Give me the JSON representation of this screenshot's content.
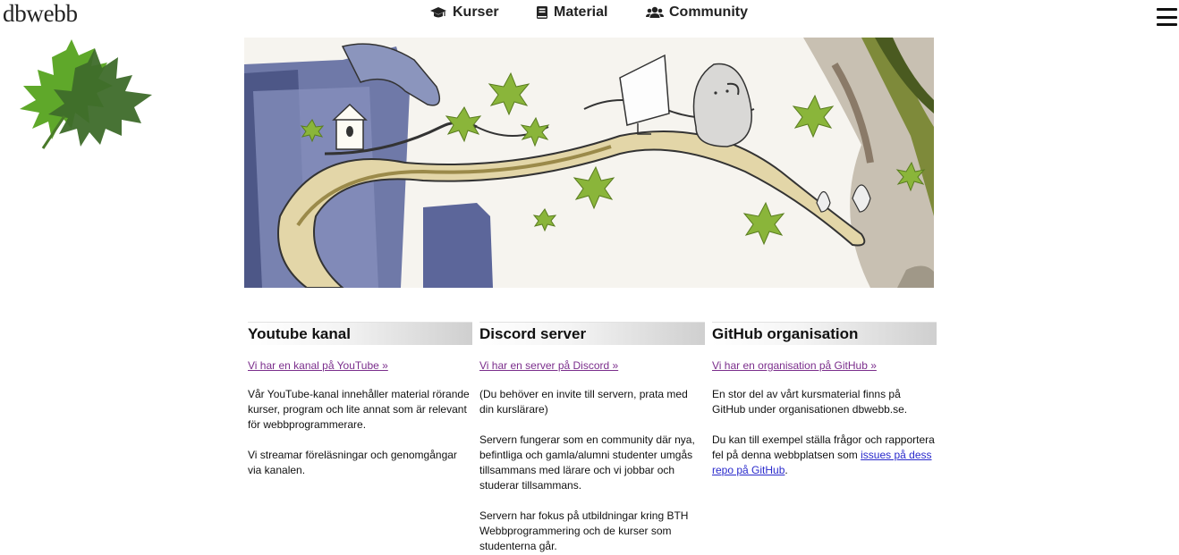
{
  "site": {
    "title": "dbwebb"
  },
  "nav": {
    "items": [
      {
        "label": "Kurser",
        "icon": "graduation-cap-icon"
      },
      {
        "label": "Material",
        "icon": "book-icon"
      },
      {
        "label": "Community",
        "icon": "users-icon"
      }
    ],
    "menu_icon": "hamburger-menu-icon"
  },
  "colors": {
    "link_visited": "#7b2e8c",
    "link": "#2a2acc",
    "leaf_light": "#5fa82a",
    "leaf_dark": "#3e6b2a"
  },
  "columns": [
    {
      "heading": "Youtube kanal",
      "link": "Vi har en kanal på YouTube »",
      "p1": "Vår YouTube-kanal innehåller material rörande kurser, program och lite annat som är relevant för webbprogrammerare.",
      "p2": "Vi streamar föreläsningar och genomgångar via kanalen."
    },
    {
      "heading": "Discord server",
      "link": "Vi har en server på Discord »",
      "p1": "(Du behöver en invite till servern, prata med din kurslärare)",
      "p2": "Servern fungerar som en community där nya, befintliga och gamla/alumni studenter umgås tillsammans med lärare och vi jobbar och studerar tillsammans.",
      "p3": "Servern har fokus på utbildningar kring BTH Webbprogrammering och de kurser som studenterna går."
    },
    {
      "heading": "GitHub organisation",
      "link": "Vi har en organisation på GitHub »",
      "p1": "En stor del av vårt kursmaterial finns på GitHub under organisationen dbwebb.se.",
      "p2_before": "Du kan till exempel ställa frågor och rapportera fel på denna webbplatsen som ",
      "p2_link": "issues på dess repo på GitHub",
      "p2_after": "."
    }
  ]
}
